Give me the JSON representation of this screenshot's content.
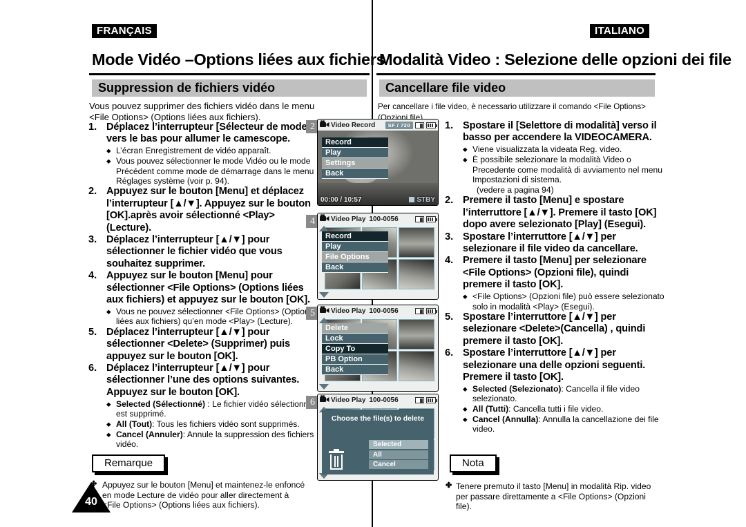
{
  "divider": true,
  "left": {
    "language": "FRANÇAIS",
    "page_title": "Mode Vidéo –Options liées aux fichiers",
    "section_title": "Suppression de fichiers vidéo",
    "intro": "Vous pouvez supprimer des fichiers vidéo dans le menu <File Options> (Options liées aux fichiers).",
    "steps": [
      {
        "num": "1.",
        "main": "Déplacez l’interrupteur [Sélecteur de mode] vers le bas pour allumer le camescope.",
        "bullets": [
          {
            "text": "L’écran Enregistrement de vidéo apparaît."
          },
          {
            "text": "Vous pouvez sélectionner le mode Vidéo ou le mode Précédent comme mode de démarrage dans le menu Réglages système (voir p. 94)."
          }
        ]
      },
      {
        "num": "2.",
        "main": "Appuyez sur le bouton [Menu] et déplacez l’interrupteur [▲/▼]. Appuyez sur le bouton [OK].après avoir sélectionné <Play> (Lecture).",
        "bullets": []
      },
      {
        "num": "3.",
        "main": "Déplacez l’interrupteur [▲/▼] pour sélectionner le fichier vidéo que vous souhaitez supprimer.",
        "bullets": []
      },
      {
        "num": "4.",
        "main": "Appuyez sur le bouton [Menu] pour sélectionner <File Options> (Options liées aux fichiers) et appuyez sur le bouton [OK].",
        "bullets": [
          {
            "text": "Vous ne pouvez sélectionner <File Options> (Options liées aux fichiers) qu’en mode <Play> (Lecture)."
          }
        ]
      },
      {
        "num": "5.",
        "main": "Déplacez l’interrupteur [▲/▼] pour sélectionner <Delete> (Supprimer) puis appuyez sur le bouton [OK].",
        "bullets": []
      },
      {
        "num": "6.",
        "main": "Déplacez l’interrupteur [▲/▼] pour sélectionner l’une des options suivantes. Appuyez sur le bouton [OK].",
        "bullets": [
          {
            "bold": "Selected (Sélectionné)",
            "text": " : Le fichier vidéo sélectionné est supprimé."
          },
          {
            "bold": "All (Tout)",
            "text": ": Tous les fichiers vidéo sont supprimés."
          },
          {
            "bold": "Cancel (Annuler)",
            "text": ": Annule la suppression des fichiers vidéo."
          }
        ]
      }
    ],
    "note_label": "Remarque",
    "note_mark": "✤",
    "note_text": "Appuyez sur le bouton [Menu] et maintenez-le enfoncé en mode Lecture de vidéo pour aller directement à <File Options> (Options liées aux fichiers)."
  },
  "right": {
    "language": "ITALIANO",
    "page_title": "Modalità Video : Selezione delle opzioni dei file",
    "section_title": "Cancellare file video",
    "intro": "Per cancellare i file video, è necessario utilizzare il comando <File Options> (Opzioni file).",
    "steps": [
      {
        "num": "1.",
        "main": "Spostare il [Selettore di modalità] verso il basso per accendere la VIDEOCAMERA.",
        "bullets": [
          {
            "text": "Viene visualizzata la videata Reg. video."
          },
          {
            "text": "È possibile selezionare la modalità Video o Precedente come modalità di avviamento nel menu Impostazioni di sistema."
          },
          {
            "text": "(vedere a pagina 94)",
            "cont": true
          }
        ]
      },
      {
        "num": "2.",
        "main": "Premere il tasto [Menu] e spostare l’interruttore [▲/▼]. Premere il tasto [OK] dopo avere selezionato [Play] (Esegui).",
        "bullets": []
      },
      {
        "num": "3.",
        "main": "Spostare l’interruttore [▲/▼] per selezionare il file video da cancellare.",
        "bullets": []
      },
      {
        "num": "4.",
        "main": "Premere il tasto [Menu] per selezionare <File Options> (Opzioni file), quindi premere il tasto [OK].",
        "bullets": [
          {
            "text": "<File Options> (Opzioni file) può essere selezionato solo in modalità <Play> (Esegui)."
          }
        ]
      },
      {
        "num": "5.",
        "main": "Spostare l’interruttore [▲/▼]  per selezionare <Delete>(Cancella) , quindi premere il tasto [OK].",
        "bullets": []
      },
      {
        "num": "6.",
        "main": "Spostare l’interruttore [▲/▼] per selezionare una delle opzioni seguenti. Premere il tasto [OK].",
        "bullets": [
          {
            "bold": "Selected (Selezionato)",
            "text": ": Cancella il file video selezionato."
          },
          {
            "bold": "All (Tutti)",
            "text": ": Cancella tutti i file video."
          },
          {
            "bold": "Cancel (Annulla)",
            "text": ": Annulla la cancellazione dei file video."
          }
        ]
      }
    ],
    "note_label": "Nota",
    "note_mark": "✤",
    "note_text": "Tenere premuto il tasto [Menu] in modalità Rip. video per passare direttamente a <File Options> (Opzioni file)."
  },
  "page_number": "40",
  "screens": [
    {
      "badge": "2",
      "header": {
        "title": "Video Record",
        "fileno": "",
        "resolution": "SF  /  720"
      },
      "menu": [
        {
          "label": "Record",
          "style": "dark"
        },
        {
          "label": "Play",
          "style": "normal"
        },
        {
          "label": "Settings",
          "style": "light"
        },
        {
          "label": "Back",
          "style": "normal"
        }
      ],
      "status": {
        "time": "00:00 / 10:57",
        "mode": "STBY"
      }
    },
    {
      "badge": "4",
      "header": {
        "title": "Video Play",
        "fileno": "100-0056",
        "resolution": ""
      },
      "menu": [
        {
          "label": "Record",
          "style": "dark"
        },
        {
          "label": "Play",
          "style": "normal"
        },
        {
          "label": "File Options",
          "style": "light"
        },
        {
          "label": "Back",
          "style": "normal"
        }
      ],
      "status": null
    },
    {
      "badge": "5",
      "header": {
        "title": "Video Play",
        "fileno": "100-0056",
        "resolution": ""
      },
      "menu": [
        {
          "label": "Delete",
          "style": "light"
        },
        {
          "label": "Lock",
          "style": "normal"
        },
        {
          "label": "Copy To",
          "style": "dark"
        },
        {
          "label": "PB Option",
          "style": "normal"
        },
        {
          "label": "Back",
          "style": "normal"
        }
      ],
      "status": null
    },
    {
      "badge": "6",
      "header": {
        "title": "Video Play",
        "fileno": "100-0056",
        "resolution": ""
      },
      "dialog": {
        "title": "Choose the file(s) to delete",
        "options": [
          {
            "label": "Selected",
            "selected": true
          },
          {
            "label": "All",
            "selected": false
          },
          {
            "label": "Cancel",
            "selected": false
          }
        ],
        "icon": "trash-icon"
      },
      "status": null
    }
  ],
  "colors": {
    "section_bar": "#c0c0c0",
    "badge_bg": "#8a8a8a",
    "lcd_menu": "#46626c",
    "lcd_menu_dark": "#13262c",
    "lcd_menu_light": "#9fa6a4"
  }
}
